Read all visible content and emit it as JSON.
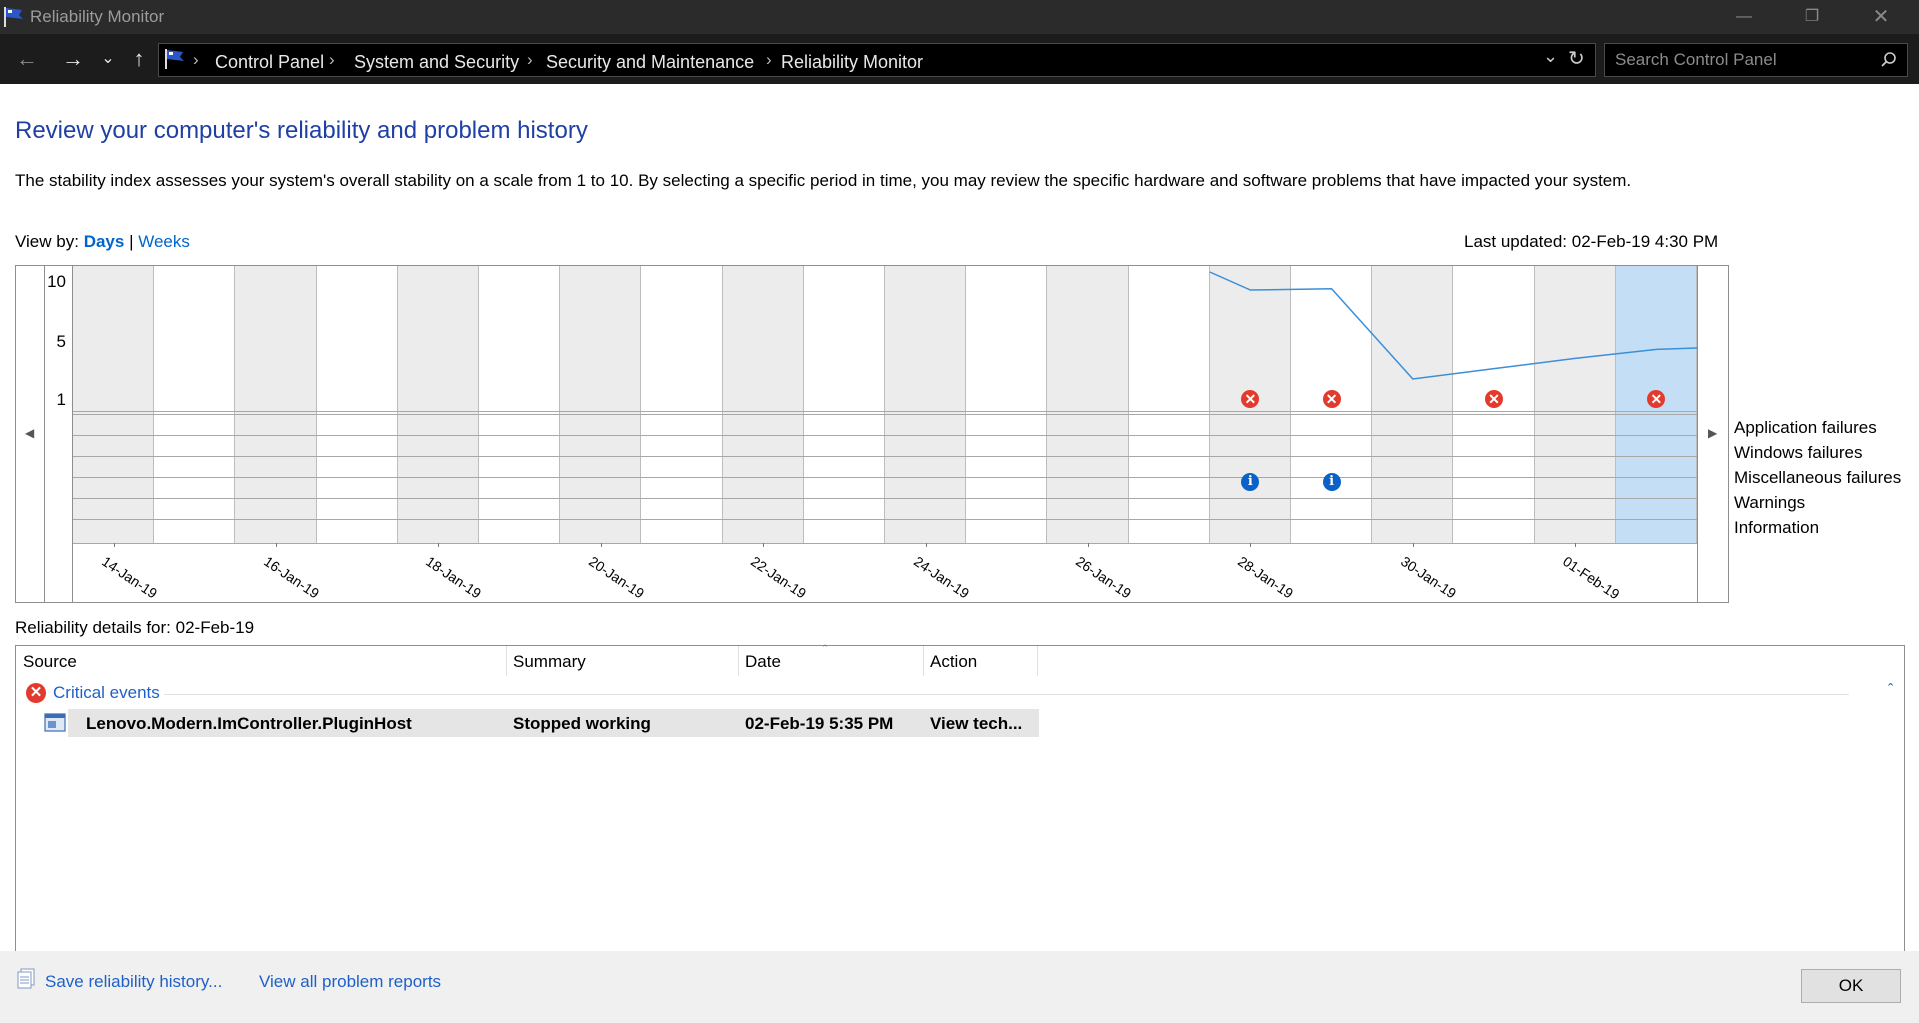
{
  "window": {
    "title": "Reliability Monitor"
  },
  "breadcrumbs": [
    "Control Panel",
    "System and Security",
    "Security and Maintenance",
    "Reliability Monitor"
  ],
  "search": {
    "placeholder": "Search Control Panel"
  },
  "heading": "Review your computer's reliability and problem history",
  "description": "The stability index assesses your system's overall stability on a scale from 1 to 10. By selecting a specific period in time, you may review the specific hardware and software problems that have impacted your system.",
  "view_by": {
    "label": "View by:",
    "days": "Days",
    "sep": "|",
    "weeks": "Weeks"
  },
  "last_updated": "Last updated: 02-Feb-19 4:30 PM",
  "chart": {
    "y_ticks": [
      "10",
      "5",
      "1"
    ],
    "dates": [
      "14-Jan-19",
      "16-Jan-19",
      "18-Jan-19",
      "20-Jan-19",
      "22-Jan-19",
      "24-Jan-19",
      "26-Jan-19",
      "28-Jan-19",
      "30-Jan-19",
      "01-Feb-19"
    ],
    "legend": [
      "Application failures",
      "Windows failures",
      "Miscellaneous failures",
      "Warnings",
      "Information"
    ],
    "stability_line": [
      {
        "day": "28-Jan-19",
        "index": 10
      },
      {
        "day": "28-Jan-19",
        "index": 8.6
      },
      {
        "day": "29-Jan-19",
        "index": 8.7
      },
      {
        "day": "30-Jan-19",
        "index": 1.7
      },
      {
        "day": "31-Jan-19",
        "index": 2.5
      },
      {
        "day": "01-Feb-19",
        "index": 3.3
      },
      {
        "day": "02-Feb-19",
        "index": 4.0
      }
    ],
    "application_failures": [
      "28-Jan-19",
      "29-Jan-19",
      "31-Jan-19",
      "02-Feb-19"
    ],
    "information_events": [
      "28-Jan-19",
      "29-Jan-19"
    ],
    "selected_day": "02-Feb-19",
    "colors": {
      "line": "#3a8fd9",
      "selected": "#c4dff5",
      "shade": "#ececec",
      "error": "#e23b2e",
      "info": "#0a62c8"
    }
  },
  "details": {
    "label": "Reliability details for: 02-Feb-19",
    "columns": [
      "Source",
      "Summary",
      "Date",
      "Action"
    ],
    "group": "Critical events",
    "rows": [
      {
        "source": "Lenovo.Modern.ImController.PluginHost",
        "summary": "Stopped working",
        "date": "02-Feb-19 5:35 PM",
        "action": "View  tech..."
      }
    ]
  },
  "footer": {
    "save": "Save reliability history...",
    "view_all": "View all problem reports",
    "ok": "OK"
  }
}
